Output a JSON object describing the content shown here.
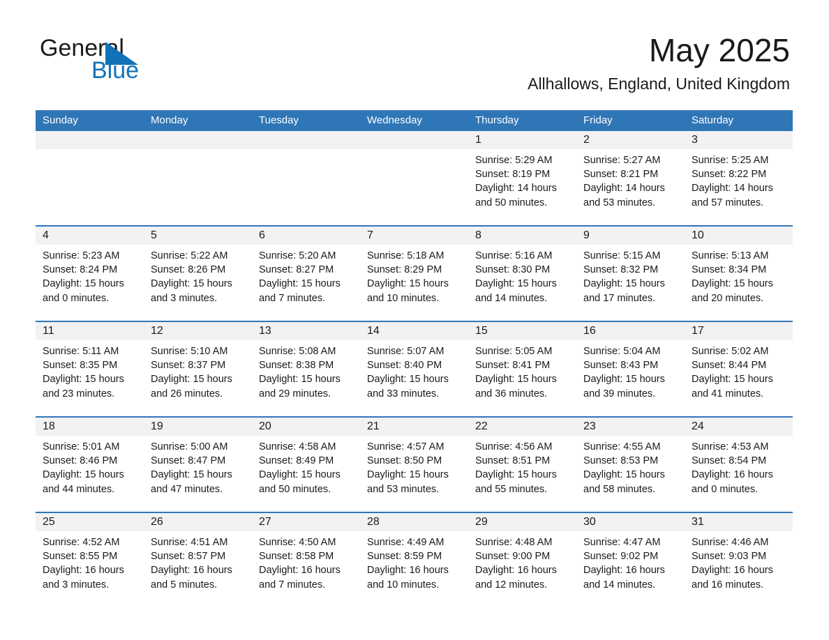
{
  "logo": {
    "word_one": "General",
    "word_two": "Blue",
    "triangle_color": "#1272b8",
    "text_color": "#1a1a1a"
  },
  "header": {
    "month_title": "May 2025",
    "location": "Allhallows, England, United Kingdom"
  },
  "theme": {
    "header_blue": "#2f76b6",
    "row_divider_blue": "#2f76b6",
    "daynum_band": "#f2f2f2",
    "page_background": "#ffffff",
    "text": "#1a1a1a"
  },
  "weekday_headers": [
    "Sunday",
    "Monday",
    "Tuesday",
    "Wednesday",
    "Thursday",
    "Friday",
    "Saturday"
  ],
  "labels": {
    "sunrise_prefix": "Sunrise:",
    "sunset_prefix": "Sunset:",
    "daylight_prefix": "Daylight:"
  },
  "weeks": [
    [
      {
        "day": "",
        "empty": true,
        "sunrise": "",
        "sunset": "",
        "daylight_line1": "",
        "daylight_line2": ""
      },
      {
        "day": "",
        "empty": true,
        "sunrise": "",
        "sunset": "",
        "daylight_line1": "",
        "daylight_line2": ""
      },
      {
        "day": "",
        "empty": true,
        "sunrise": "",
        "sunset": "",
        "daylight_line1": "",
        "daylight_line2": ""
      },
      {
        "day": "",
        "empty": true,
        "sunrise": "",
        "sunset": "",
        "daylight_line1": "",
        "daylight_line2": ""
      },
      {
        "day": "1",
        "empty": false,
        "sunrise": "Sunrise: 5:29 AM",
        "sunset": "Sunset: 8:19 PM",
        "daylight_line1": "Daylight: 14 hours",
        "daylight_line2": "and 50 minutes."
      },
      {
        "day": "2",
        "empty": false,
        "sunrise": "Sunrise: 5:27 AM",
        "sunset": "Sunset: 8:21 PM",
        "daylight_line1": "Daylight: 14 hours",
        "daylight_line2": "and 53 minutes."
      },
      {
        "day": "3",
        "empty": false,
        "sunrise": "Sunrise: 5:25 AM",
        "sunset": "Sunset: 8:22 PM",
        "daylight_line1": "Daylight: 14 hours",
        "daylight_line2": "and 57 minutes."
      }
    ],
    [
      {
        "day": "4",
        "empty": false,
        "sunrise": "Sunrise: 5:23 AM",
        "sunset": "Sunset: 8:24 PM",
        "daylight_line1": "Daylight: 15 hours",
        "daylight_line2": "and 0 minutes."
      },
      {
        "day": "5",
        "empty": false,
        "sunrise": "Sunrise: 5:22 AM",
        "sunset": "Sunset: 8:26 PM",
        "daylight_line1": "Daylight: 15 hours",
        "daylight_line2": "and 3 minutes."
      },
      {
        "day": "6",
        "empty": false,
        "sunrise": "Sunrise: 5:20 AM",
        "sunset": "Sunset: 8:27 PM",
        "daylight_line1": "Daylight: 15 hours",
        "daylight_line2": "and 7 minutes."
      },
      {
        "day": "7",
        "empty": false,
        "sunrise": "Sunrise: 5:18 AM",
        "sunset": "Sunset: 8:29 PM",
        "daylight_line1": "Daylight: 15 hours",
        "daylight_line2": "and 10 minutes."
      },
      {
        "day": "8",
        "empty": false,
        "sunrise": "Sunrise: 5:16 AM",
        "sunset": "Sunset: 8:30 PM",
        "daylight_line1": "Daylight: 15 hours",
        "daylight_line2": "and 14 minutes."
      },
      {
        "day": "9",
        "empty": false,
        "sunrise": "Sunrise: 5:15 AM",
        "sunset": "Sunset: 8:32 PM",
        "daylight_line1": "Daylight: 15 hours",
        "daylight_line2": "and 17 minutes."
      },
      {
        "day": "10",
        "empty": false,
        "sunrise": "Sunrise: 5:13 AM",
        "sunset": "Sunset: 8:34 PM",
        "daylight_line1": "Daylight: 15 hours",
        "daylight_line2": "and 20 minutes."
      }
    ],
    [
      {
        "day": "11",
        "empty": false,
        "sunrise": "Sunrise: 5:11 AM",
        "sunset": "Sunset: 8:35 PM",
        "daylight_line1": "Daylight: 15 hours",
        "daylight_line2": "and 23 minutes."
      },
      {
        "day": "12",
        "empty": false,
        "sunrise": "Sunrise: 5:10 AM",
        "sunset": "Sunset: 8:37 PM",
        "daylight_line1": "Daylight: 15 hours",
        "daylight_line2": "and 26 minutes."
      },
      {
        "day": "13",
        "empty": false,
        "sunrise": "Sunrise: 5:08 AM",
        "sunset": "Sunset: 8:38 PM",
        "daylight_line1": "Daylight: 15 hours",
        "daylight_line2": "and 29 minutes."
      },
      {
        "day": "14",
        "empty": false,
        "sunrise": "Sunrise: 5:07 AM",
        "sunset": "Sunset: 8:40 PM",
        "daylight_line1": "Daylight: 15 hours",
        "daylight_line2": "and 33 minutes."
      },
      {
        "day": "15",
        "empty": false,
        "sunrise": "Sunrise: 5:05 AM",
        "sunset": "Sunset: 8:41 PM",
        "daylight_line1": "Daylight: 15 hours",
        "daylight_line2": "and 36 minutes."
      },
      {
        "day": "16",
        "empty": false,
        "sunrise": "Sunrise: 5:04 AM",
        "sunset": "Sunset: 8:43 PM",
        "daylight_line1": "Daylight: 15 hours",
        "daylight_line2": "and 39 minutes."
      },
      {
        "day": "17",
        "empty": false,
        "sunrise": "Sunrise: 5:02 AM",
        "sunset": "Sunset: 8:44 PM",
        "daylight_line1": "Daylight: 15 hours",
        "daylight_line2": "and 41 minutes."
      }
    ],
    [
      {
        "day": "18",
        "empty": false,
        "sunrise": "Sunrise: 5:01 AM",
        "sunset": "Sunset: 8:46 PM",
        "daylight_line1": "Daylight: 15 hours",
        "daylight_line2": "and 44 minutes."
      },
      {
        "day": "19",
        "empty": false,
        "sunrise": "Sunrise: 5:00 AM",
        "sunset": "Sunset: 8:47 PM",
        "daylight_line1": "Daylight: 15 hours",
        "daylight_line2": "and 47 minutes."
      },
      {
        "day": "20",
        "empty": false,
        "sunrise": "Sunrise: 4:58 AM",
        "sunset": "Sunset: 8:49 PM",
        "daylight_line1": "Daylight: 15 hours",
        "daylight_line2": "and 50 minutes."
      },
      {
        "day": "21",
        "empty": false,
        "sunrise": "Sunrise: 4:57 AM",
        "sunset": "Sunset: 8:50 PM",
        "daylight_line1": "Daylight: 15 hours",
        "daylight_line2": "and 53 minutes."
      },
      {
        "day": "22",
        "empty": false,
        "sunrise": "Sunrise: 4:56 AM",
        "sunset": "Sunset: 8:51 PM",
        "daylight_line1": "Daylight: 15 hours",
        "daylight_line2": "and 55 minutes."
      },
      {
        "day": "23",
        "empty": false,
        "sunrise": "Sunrise: 4:55 AM",
        "sunset": "Sunset: 8:53 PM",
        "daylight_line1": "Daylight: 15 hours",
        "daylight_line2": "and 58 minutes."
      },
      {
        "day": "24",
        "empty": false,
        "sunrise": "Sunrise: 4:53 AM",
        "sunset": "Sunset: 8:54 PM",
        "daylight_line1": "Daylight: 16 hours",
        "daylight_line2": "and 0 minutes."
      }
    ],
    [
      {
        "day": "25",
        "empty": false,
        "sunrise": "Sunrise: 4:52 AM",
        "sunset": "Sunset: 8:55 PM",
        "daylight_line1": "Daylight: 16 hours",
        "daylight_line2": "and 3 minutes."
      },
      {
        "day": "26",
        "empty": false,
        "sunrise": "Sunrise: 4:51 AM",
        "sunset": "Sunset: 8:57 PM",
        "daylight_line1": "Daylight: 16 hours",
        "daylight_line2": "and 5 minutes."
      },
      {
        "day": "27",
        "empty": false,
        "sunrise": "Sunrise: 4:50 AM",
        "sunset": "Sunset: 8:58 PM",
        "daylight_line1": "Daylight: 16 hours",
        "daylight_line2": "and 7 minutes."
      },
      {
        "day": "28",
        "empty": false,
        "sunrise": "Sunrise: 4:49 AM",
        "sunset": "Sunset: 8:59 PM",
        "daylight_line1": "Daylight: 16 hours",
        "daylight_line2": "and 10 minutes."
      },
      {
        "day": "29",
        "empty": false,
        "sunrise": "Sunrise: 4:48 AM",
        "sunset": "Sunset: 9:00 PM",
        "daylight_line1": "Daylight: 16 hours",
        "daylight_line2": "and 12 minutes."
      },
      {
        "day": "30",
        "empty": false,
        "sunrise": "Sunrise: 4:47 AM",
        "sunset": "Sunset: 9:02 PM",
        "daylight_line1": "Daylight: 16 hours",
        "daylight_line2": "and 14 minutes."
      },
      {
        "day": "31",
        "empty": false,
        "sunrise": "Sunrise: 4:46 AM",
        "sunset": "Sunset: 9:03 PM",
        "daylight_line1": "Daylight: 16 hours",
        "daylight_line2": "and 16 minutes."
      }
    ]
  ]
}
